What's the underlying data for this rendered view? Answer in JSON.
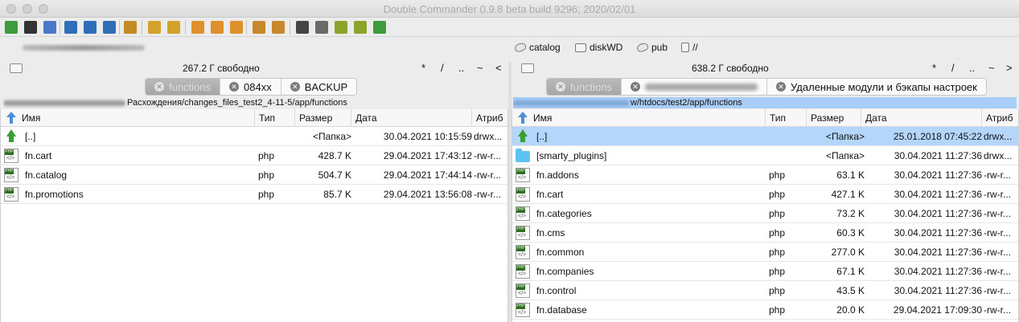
{
  "app": {
    "title": "Double Commander 0.9.8 beta build 9296; 2020/02/01"
  },
  "toolbar": {
    "buttons": [
      {
        "icon": "refresh-icon",
        "color": "#3c9c3c"
      },
      {
        "icon": "terminal-icon",
        "color": "#333333"
      },
      {
        "icon": "settings-icon",
        "color": "#4a78c8"
      },
      {
        "icon": "brief-view-icon",
        "color": "#2f6fb7"
      },
      {
        "icon": "full-view-icon",
        "color": "#2f6fb7"
      },
      {
        "icon": "thumbnails-view-icon",
        "color": "#2f6fb7"
      },
      {
        "icon": "compare-icon",
        "color": "#c48a24"
      },
      {
        "icon": "copy-left-icon",
        "color": "#d2a22a"
      },
      {
        "icon": "copy-right-icon",
        "color": "#d2a22a"
      },
      {
        "icon": "multi-rename-icon",
        "color": "#e0902a"
      },
      {
        "icon": "pack-icon",
        "color": "#e0902a"
      },
      {
        "icon": "unpack-icon",
        "color": "#e0902a"
      },
      {
        "icon": "archive-icon",
        "color": "#c9872c"
      },
      {
        "icon": "extract-icon",
        "color": "#c9872c"
      },
      {
        "icon": "search-icon",
        "color": "#444444"
      },
      {
        "icon": "edit-icon",
        "color": "#6a6a6a"
      },
      {
        "icon": "file-list-icon",
        "color": "#8ba42a"
      },
      {
        "icon": "copy-files-icon",
        "color": "#8ba42a"
      },
      {
        "icon": "sync-dirs-icon",
        "color": "#3c9c3c"
      }
    ]
  },
  "drives": {
    "items": [
      {
        "label": "catalog",
        "icon": "network-drive-icon"
      },
      {
        "label": "diskWD",
        "icon": "disk-icon"
      },
      {
        "label": "pub",
        "icon": "network-drive-icon"
      },
      {
        "label": "//",
        "icon": "network-icon"
      }
    ]
  },
  "left": {
    "free": "267.2 Г свободно",
    "nav": [
      "*",
      "/",
      "..",
      "~",
      "<"
    ],
    "tabs": [
      {
        "label": "functions",
        "active": true
      },
      {
        "label": "084xx",
        "active": false
      },
      {
        "label": "BACKUP",
        "active": false
      }
    ],
    "path": "Расхождения/changes_files_test2_4-11-5/app/functions",
    "columns": [
      "Имя",
      "Тип",
      "Размер",
      "Дата",
      "Атриб"
    ],
    "rows": [
      {
        "name": "[..]",
        "type": "",
        "size": "<Папка>",
        "date": "30.04.2021 10:15:59",
        "attr": "drwx...",
        "icon": "up"
      },
      {
        "name": "fn.cart",
        "type": "php",
        "size": "428.7 K",
        "date": "29.04.2021 17:43:12",
        "attr": "-rw-r...",
        "icon": "php"
      },
      {
        "name": "fn.catalog",
        "type": "php",
        "size": "504.7 K",
        "date": "29.04.2021 17:44:14",
        "attr": "-rw-r...",
        "icon": "php"
      },
      {
        "name": "fn.promotions",
        "type": "php",
        "size": "85.7 K",
        "date": "29.04.2021 13:56:08",
        "attr": "-rw-r...",
        "icon": "php"
      }
    ]
  },
  "right": {
    "free": "638.2 Г свободно",
    "nav": [
      "*",
      "/",
      "..",
      "~",
      ">"
    ],
    "tabs": [
      {
        "label": "functions",
        "active": true
      },
      {
        "label": "",
        "active": false,
        "blurred": true
      },
      {
        "label": "Удаленные модули и бэкапы настроек",
        "active": false
      }
    ],
    "path": "w/htdocs/test2/app/functions",
    "columns": [
      "Имя",
      "Тип",
      "Размер",
      "Дата",
      "Атриб"
    ],
    "rows": [
      {
        "name": "[..]",
        "type": "",
        "size": "<Папка>",
        "date": "25.01.2018 07:45:22",
        "attr": "drwx...",
        "icon": "up",
        "selected": true
      },
      {
        "name": "[smarty_plugins]",
        "type": "",
        "size": "<Папка>",
        "date": "30.04.2021 11:27:36",
        "attr": "drwx...",
        "icon": "folder"
      },
      {
        "name": "fn.addons",
        "type": "php",
        "size": "63.1 K",
        "date": "30.04.2021 11:27:36",
        "attr": "-rw-r...",
        "icon": "php"
      },
      {
        "name": "fn.cart",
        "type": "php",
        "size": "427.1 K",
        "date": "30.04.2021 11:27:36",
        "attr": "-rw-r...",
        "icon": "php"
      },
      {
        "name": "fn.categories",
        "type": "php",
        "size": "73.2 K",
        "date": "30.04.2021 11:27:36",
        "attr": "-rw-r...",
        "icon": "php"
      },
      {
        "name": "fn.cms",
        "type": "php",
        "size": "60.3 K",
        "date": "30.04.2021 11:27:36",
        "attr": "-rw-r...",
        "icon": "php"
      },
      {
        "name": "fn.common",
        "type": "php",
        "size": "277.0 K",
        "date": "30.04.2021 11:27:36",
        "attr": "-rw-r...",
        "icon": "php"
      },
      {
        "name": "fn.companies",
        "type": "php",
        "size": "67.1 K",
        "date": "30.04.2021 11:27:36",
        "attr": "-rw-r...",
        "icon": "php"
      },
      {
        "name": "fn.control",
        "type": "php",
        "size": "43.5 K",
        "date": "30.04.2021 11:27:36",
        "attr": "-rw-r...",
        "icon": "php"
      },
      {
        "name": "fn.database",
        "type": "php",
        "size": "20.0 K",
        "date": "29.04.2021 17:09:30",
        "attr": "-rw-r...",
        "icon": "php"
      }
    ]
  }
}
